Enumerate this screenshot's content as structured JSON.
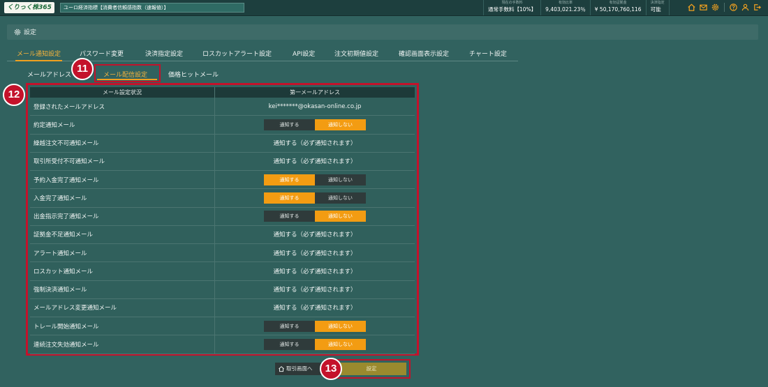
{
  "topbar": {
    "logo": "くりっく株365",
    "ticker": "ユーロ経済指標【消費者信頼感指数（速報値）】",
    "stats": [
      {
        "label": "現在の手数料",
        "value": "通常手数料【10%】"
      },
      {
        "label": "有効比率",
        "value": "9,403,021.23％"
      },
      {
        "label": "有効証拠金",
        "value": "¥ 50,170,760,116"
      },
      {
        "label": "決済指定",
        "value": "可能"
      }
    ],
    "icons": [
      "home-icon",
      "mail-icon",
      "gear-icon",
      "help-icon",
      "user-icon",
      "logout-icon"
    ]
  },
  "header": {
    "title": "設定"
  },
  "main_tabs": [
    "メール通知設定",
    "パスワード変更",
    "決済指定設定",
    "ロスカットアラート設定",
    "API設定",
    "注文初期値設定",
    "確認画面表示設定",
    "チャート設定"
  ],
  "sub_tabs": [
    "メールアドレス",
    "メール配信設定",
    "価格ヒットメール"
  ],
  "table": {
    "headers": [
      "メール設定状況",
      "第一メールアドレス"
    ],
    "rows": [
      {
        "label": "登録されたメールアドレス",
        "value": "kei*******@okasan-online.co.jp"
      },
      {
        "label": "約定通知メール",
        "toggle": [
          "通知する",
          "通知しない"
        ],
        "selected": 1
      },
      {
        "label": "繰越注文不可通知メール",
        "value": "通知する（必ず通知されます）"
      },
      {
        "label": "取引所受付不可通知メール",
        "value": "通知する（必ず通知されます）"
      },
      {
        "label": "予約入金完了通知メール",
        "toggle": [
          "通知する",
          "通知しない"
        ],
        "selected": 0
      },
      {
        "label": "入金完了通知メール",
        "toggle": [
          "通知する",
          "通知しない"
        ],
        "selected": 0
      },
      {
        "label": "出金指示完了通知メール",
        "toggle": [
          "通知する",
          "通知しない"
        ],
        "selected": 1
      },
      {
        "label": "証拠金不足通知メール",
        "value": "通知する（必ず通知されます）"
      },
      {
        "label": "アラート通知メール",
        "value": "通知する（必ず通知されます）"
      },
      {
        "label": "ロスカット通知メール",
        "value": "通知する（必ず通知されます）"
      },
      {
        "label": "強制決済通知メール",
        "value": "通知する（必ず通知されます）"
      },
      {
        "label": "メールアドレス変更通知メール",
        "value": "通知する（必ず通知されます）"
      },
      {
        "label": "トレール開始通知メール",
        "toggle": [
          "通知する",
          "通知しない"
        ],
        "selected": 1
      },
      {
        "label": "連続注文失効通知メール",
        "toggle": [
          "通知する",
          "通知しない"
        ],
        "selected": 1
      }
    ]
  },
  "buttons": {
    "home": "取引画面へ",
    "submit": "設定"
  },
  "callouts": [
    "11",
    "12",
    "13"
  ]
}
